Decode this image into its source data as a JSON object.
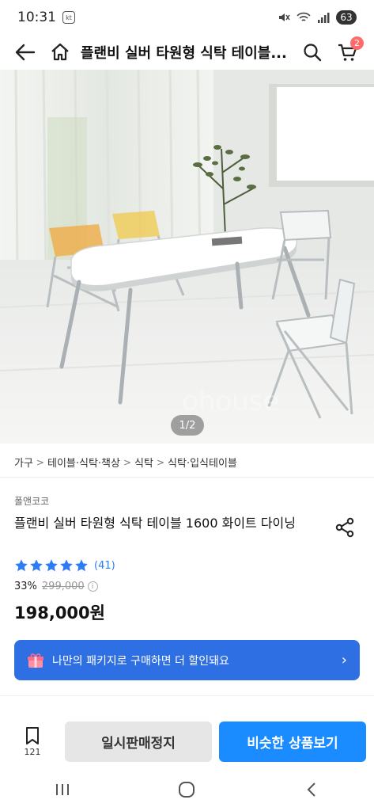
{
  "status_bar": {
    "time": "10:31",
    "carrier_badge": "kt",
    "battery": "63"
  },
  "nav": {
    "title": "플랜비 실버 타원형 식탁 테이블...",
    "cart_count": "2"
  },
  "gallery": {
    "page_indicator": "1/2"
  },
  "breadcrumb": [
    "가구",
    "테이블·식탁·책상",
    "식탁",
    "식탁·입식테이블"
  ],
  "product": {
    "brand": "폴앤코코",
    "title": "플랜비 실버 타원형 식탁 테이블 1600 화이트 다이닝",
    "rating_stars": 5,
    "review_count": "(41)",
    "discount_rate": "33%",
    "original_price": "299,000",
    "price": "198,000원"
  },
  "package_banner": {
    "text": "나만의 패키지로 구매하면 더 할인돼요"
  },
  "action_bar": {
    "bookmark_count": "121",
    "soldout_label": "일시판매정지",
    "similar_label": "비슷한 상품보기"
  },
  "colors": {
    "accent_blue": "#1a8cff",
    "banner_blue": "#2f6fe4",
    "star_blue": "#2d7cf6",
    "cart_badge": "#ff6b6b"
  },
  "icons": {
    "back": "back-arrow-icon",
    "home": "home-icon",
    "search": "search-icon",
    "cart": "cart-icon",
    "share": "share-icon",
    "gift": "gift-icon",
    "bookmark": "bookmark-icon"
  }
}
